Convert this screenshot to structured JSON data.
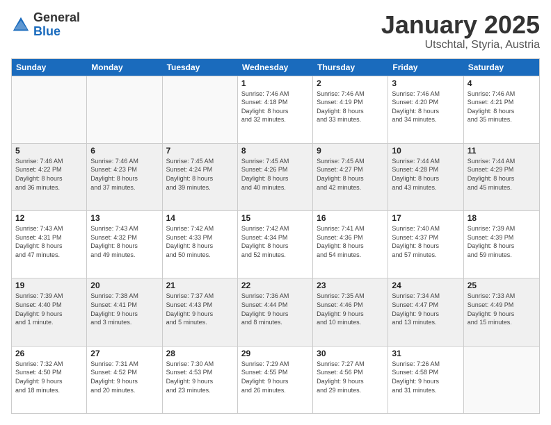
{
  "logo": {
    "general": "General",
    "blue": "Blue"
  },
  "title": "January 2025",
  "location": "Utschtal, Styria, Austria",
  "days": [
    "Sunday",
    "Monday",
    "Tuesday",
    "Wednesday",
    "Thursday",
    "Friday",
    "Saturday"
  ],
  "weeks": [
    [
      {
        "day": "",
        "text": ""
      },
      {
        "day": "",
        "text": ""
      },
      {
        "day": "",
        "text": ""
      },
      {
        "day": "1",
        "text": "Sunrise: 7:46 AM\nSunset: 4:18 PM\nDaylight: 8 hours\nand 32 minutes."
      },
      {
        "day": "2",
        "text": "Sunrise: 7:46 AM\nSunset: 4:19 PM\nDaylight: 8 hours\nand 33 minutes."
      },
      {
        "day": "3",
        "text": "Sunrise: 7:46 AM\nSunset: 4:20 PM\nDaylight: 8 hours\nand 34 minutes."
      },
      {
        "day": "4",
        "text": "Sunrise: 7:46 AM\nSunset: 4:21 PM\nDaylight: 8 hours\nand 35 minutes."
      }
    ],
    [
      {
        "day": "5",
        "text": "Sunrise: 7:46 AM\nSunset: 4:22 PM\nDaylight: 8 hours\nand 36 minutes."
      },
      {
        "day": "6",
        "text": "Sunrise: 7:46 AM\nSunset: 4:23 PM\nDaylight: 8 hours\nand 37 minutes."
      },
      {
        "day": "7",
        "text": "Sunrise: 7:45 AM\nSunset: 4:24 PM\nDaylight: 8 hours\nand 39 minutes."
      },
      {
        "day": "8",
        "text": "Sunrise: 7:45 AM\nSunset: 4:26 PM\nDaylight: 8 hours\nand 40 minutes."
      },
      {
        "day": "9",
        "text": "Sunrise: 7:45 AM\nSunset: 4:27 PM\nDaylight: 8 hours\nand 42 minutes."
      },
      {
        "day": "10",
        "text": "Sunrise: 7:44 AM\nSunset: 4:28 PM\nDaylight: 8 hours\nand 43 minutes."
      },
      {
        "day": "11",
        "text": "Sunrise: 7:44 AM\nSunset: 4:29 PM\nDaylight: 8 hours\nand 45 minutes."
      }
    ],
    [
      {
        "day": "12",
        "text": "Sunrise: 7:43 AM\nSunset: 4:31 PM\nDaylight: 8 hours\nand 47 minutes."
      },
      {
        "day": "13",
        "text": "Sunrise: 7:43 AM\nSunset: 4:32 PM\nDaylight: 8 hours\nand 49 minutes."
      },
      {
        "day": "14",
        "text": "Sunrise: 7:42 AM\nSunset: 4:33 PM\nDaylight: 8 hours\nand 50 minutes."
      },
      {
        "day": "15",
        "text": "Sunrise: 7:42 AM\nSunset: 4:34 PM\nDaylight: 8 hours\nand 52 minutes."
      },
      {
        "day": "16",
        "text": "Sunrise: 7:41 AM\nSunset: 4:36 PM\nDaylight: 8 hours\nand 54 minutes."
      },
      {
        "day": "17",
        "text": "Sunrise: 7:40 AM\nSunset: 4:37 PM\nDaylight: 8 hours\nand 57 minutes."
      },
      {
        "day": "18",
        "text": "Sunrise: 7:39 AM\nSunset: 4:39 PM\nDaylight: 8 hours\nand 59 minutes."
      }
    ],
    [
      {
        "day": "19",
        "text": "Sunrise: 7:39 AM\nSunset: 4:40 PM\nDaylight: 9 hours\nand 1 minute."
      },
      {
        "day": "20",
        "text": "Sunrise: 7:38 AM\nSunset: 4:41 PM\nDaylight: 9 hours\nand 3 minutes."
      },
      {
        "day": "21",
        "text": "Sunrise: 7:37 AM\nSunset: 4:43 PM\nDaylight: 9 hours\nand 5 minutes."
      },
      {
        "day": "22",
        "text": "Sunrise: 7:36 AM\nSunset: 4:44 PM\nDaylight: 9 hours\nand 8 minutes."
      },
      {
        "day": "23",
        "text": "Sunrise: 7:35 AM\nSunset: 4:46 PM\nDaylight: 9 hours\nand 10 minutes."
      },
      {
        "day": "24",
        "text": "Sunrise: 7:34 AM\nSunset: 4:47 PM\nDaylight: 9 hours\nand 13 minutes."
      },
      {
        "day": "25",
        "text": "Sunrise: 7:33 AM\nSunset: 4:49 PM\nDaylight: 9 hours\nand 15 minutes."
      }
    ],
    [
      {
        "day": "26",
        "text": "Sunrise: 7:32 AM\nSunset: 4:50 PM\nDaylight: 9 hours\nand 18 minutes."
      },
      {
        "day": "27",
        "text": "Sunrise: 7:31 AM\nSunset: 4:52 PM\nDaylight: 9 hours\nand 20 minutes."
      },
      {
        "day": "28",
        "text": "Sunrise: 7:30 AM\nSunset: 4:53 PM\nDaylight: 9 hours\nand 23 minutes."
      },
      {
        "day": "29",
        "text": "Sunrise: 7:29 AM\nSunset: 4:55 PM\nDaylight: 9 hours\nand 26 minutes."
      },
      {
        "day": "30",
        "text": "Sunrise: 7:27 AM\nSunset: 4:56 PM\nDaylight: 9 hours\nand 29 minutes."
      },
      {
        "day": "31",
        "text": "Sunrise: 7:26 AM\nSunset: 4:58 PM\nDaylight: 9 hours\nand 31 minutes."
      },
      {
        "day": "",
        "text": ""
      }
    ]
  ]
}
